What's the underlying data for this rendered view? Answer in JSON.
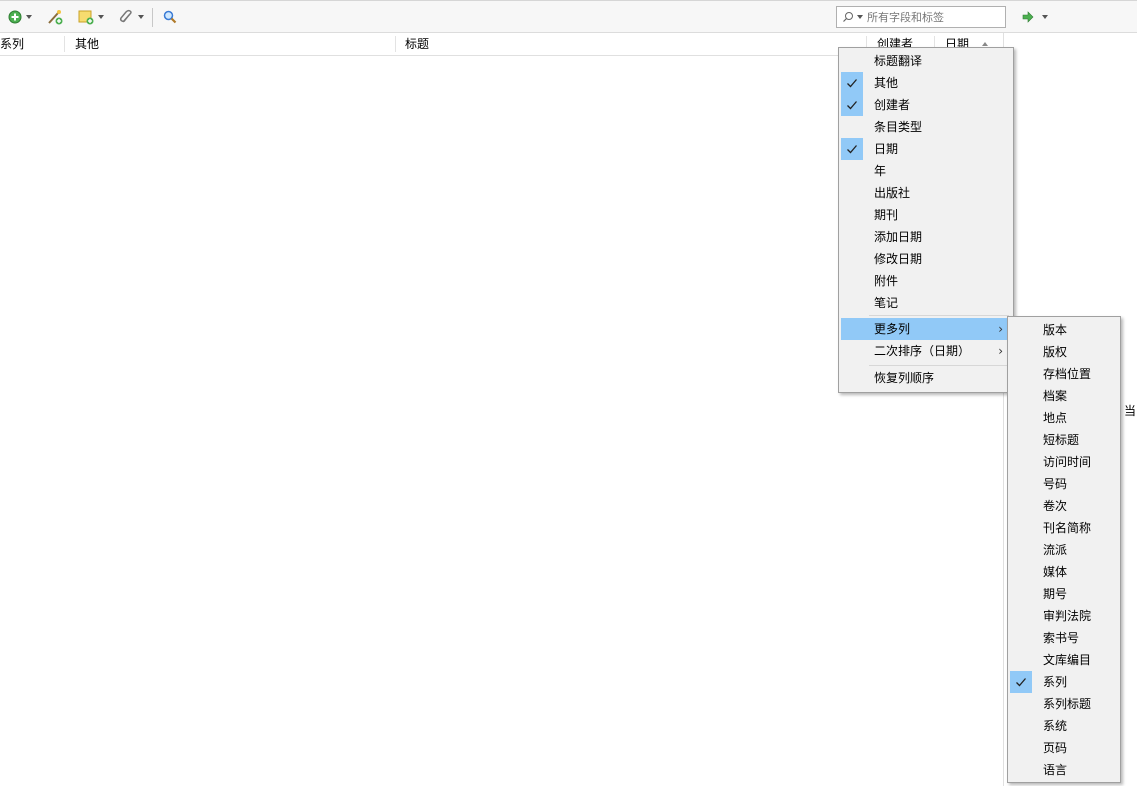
{
  "toolbar": {
    "search_placeholder": "所有字段和标签"
  },
  "columns": {
    "series": "系列",
    "other": "其他",
    "title": "标题",
    "creator": "创建者",
    "date": "日期"
  },
  "edge_text": "当",
  "context_menu": {
    "items": [
      {
        "label": "标题翻译",
        "checked": false
      },
      {
        "label": "其他",
        "checked": true
      },
      {
        "label": "创建者",
        "checked": true
      },
      {
        "label": "条目类型",
        "checked": false
      },
      {
        "label": "日期",
        "checked": true
      },
      {
        "label": "年",
        "checked": false
      },
      {
        "label": "出版社",
        "checked": false
      },
      {
        "label": "期刊",
        "checked": false
      },
      {
        "label": "添加日期",
        "checked": false
      },
      {
        "label": "修改日期",
        "checked": false
      },
      {
        "label": "附件",
        "checked": false
      },
      {
        "label": "笔记",
        "checked": false
      }
    ],
    "more_columns": "更多列",
    "secondary_sort": "二次排序（日期）",
    "restore_order": "恢复列顺序"
  },
  "submenu": {
    "items": [
      {
        "label": "版本",
        "checked": false
      },
      {
        "label": "版权",
        "checked": false
      },
      {
        "label": "存档位置",
        "checked": false
      },
      {
        "label": "档案",
        "checked": false
      },
      {
        "label": "地点",
        "checked": false
      },
      {
        "label": "短标题",
        "checked": false
      },
      {
        "label": "访问时间",
        "checked": false
      },
      {
        "label": "号码",
        "checked": false
      },
      {
        "label": "卷次",
        "checked": false
      },
      {
        "label": "刊名简称",
        "checked": false
      },
      {
        "label": "流派",
        "checked": false
      },
      {
        "label": "媒体",
        "checked": false
      },
      {
        "label": "期号",
        "checked": false
      },
      {
        "label": "审判法院",
        "checked": false
      },
      {
        "label": "索书号",
        "checked": false
      },
      {
        "label": "文库编目",
        "checked": false
      },
      {
        "label": "系列",
        "checked": true
      },
      {
        "label": "系列标题",
        "checked": false
      },
      {
        "label": "系统",
        "checked": false
      },
      {
        "label": "页码",
        "checked": false
      },
      {
        "label": "语言",
        "checked": false
      }
    ]
  },
  "colors": {
    "highlight": "#91c9f7",
    "menu_bg": "#f1f1f1"
  }
}
